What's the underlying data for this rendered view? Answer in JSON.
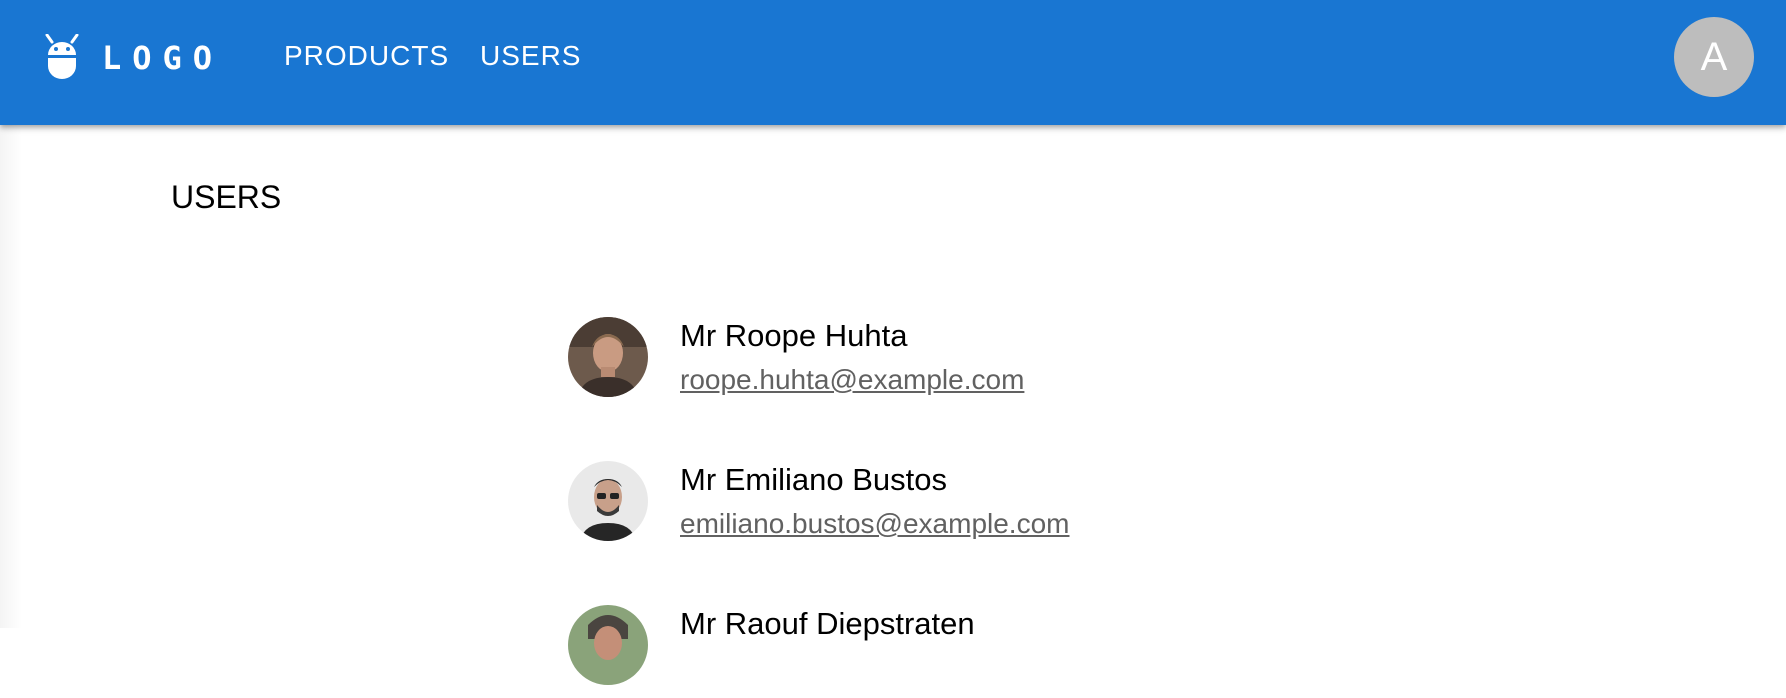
{
  "header": {
    "logo_text": "LOGO",
    "logo_icon": "android-icon",
    "nav": [
      {
        "label": "PRODUCTS"
      },
      {
        "label": "USERS"
      }
    ],
    "account_initial": "A",
    "colors": {
      "appbar": "#1976d2",
      "avatar": "#bdbdbd"
    }
  },
  "main": {
    "title": "USERS",
    "users": [
      {
        "name": "Mr Roope Huhta",
        "email": "roope.huhta@example.com"
      },
      {
        "name": "Mr Emiliano Bustos",
        "email": "emiliano.bustos@example.com"
      },
      {
        "name": "Mr Raouf Diepstraten",
        "email": ""
      }
    ]
  }
}
